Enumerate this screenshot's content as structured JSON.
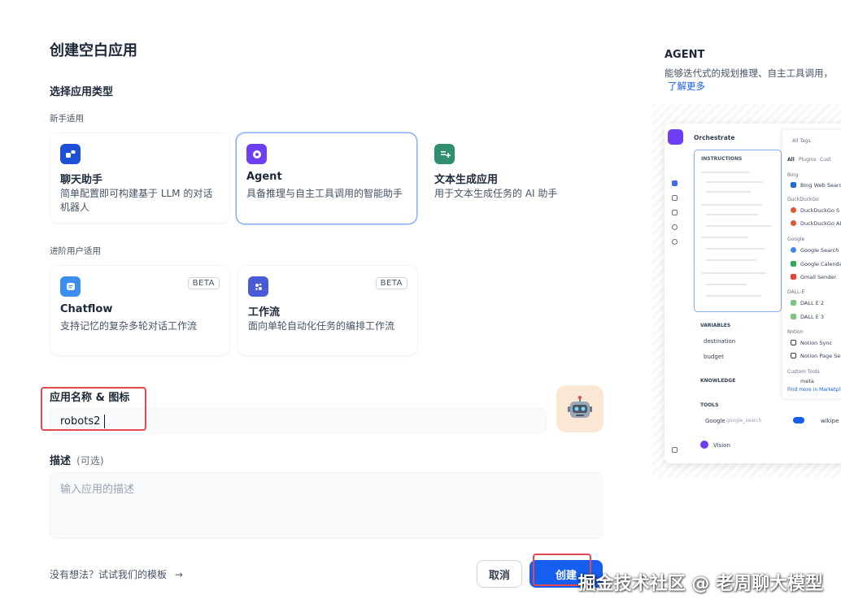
{
  "dialog": {
    "title": "创建空白应用",
    "type_section": "选择应用类型",
    "beginner_label": "新手适用",
    "advanced_label": "进阶用户适用",
    "app_types_beginner": [
      {
        "name": "聊天助手",
        "desc": "简单配置即可构建基于 LLM 的对话机器人",
        "icon": "chat-bot-icon",
        "color": "#1e4fd8"
      },
      {
        "name": "Agent",
        "desc": "具备推理与自主工具调用的智能助手",
        "icon": "agent-icon",
        "color": "#6e3ef2",
        "selected": true
      },
      {
        "name": "文本生成应用",
        "desc": "用于文本生成任务的 AI 助手",
        "icon": "text-generate-icon",
        "color": "#2f8f6f"
      }
    ],
    "app_types_advanced": [
      {
        "name": "Chatflow",
        "desc": "支持记忆的复杂多轮对话工作流",
        "icon": "chatflow-icon",
        "color": "#3b8df0",
        "badge": "BETA"
      },
      {
        "name": "工作流",
        "desc": "面向单轮自动化任务的编排工作流",
        "icon": "workflow-icon",
        "color": "#4a5bd6",
        "badge": "BETA"
      }
    ],
    "name_section": "应用名称 & 图标",
    "name_value": "robots2",
    "app_icon": "robot-emoji-icon",
    "app_icon_glyph": "🤖",
    "desc_section": "描述",
    "desc_optional": "(可选)",
    "desc_placeholder": "输入应用的描述",
    "template_hint": "没有想法？试试我们的模板",
    "template_arrow": "→",
    "cancel_label": "取消",
    "create_label": "创建"
  },
  "preview": {
    "heading": "AGENT",
    "desc": "能够迭代式的规划推理、自主工具调用，",
    "learn_more": "了解更多",
    "orchestrate": "Orchestrate",
    "instructions": "INSTRUCTIONS",
    "variables": "VARIABLES",
    "var1": "destination",
    "var2": "budget",
    "knowledge": "KNOWLEDGE",
    "tools": "TOOLS",
    "tool1": "Google",
    "tool1_sub": "google_search",
    "tool2": "wikipe",
    "vision": "Vision",
    "all_tags": "All Tags",
    "tab_all": "All",
    "tab_plugins": "Plugins",
    "tab_custom": "Cust",
    "groups": [
      {
        "label": "Bing",
        "items": [
          "Bing Web Search"
        ]
      },
      {
        "label": "DuckDuckGo",
        "items": [
          "DuckDuckGo S",
          "DuckDuckGo AI"
        ]
      },
      {
        "label": "Google",
        "items": [
          "Google Search",
          "Google Calenda",
          "Gmail Sender"
        ]
      },
      {
        "label": "DALL-E",
        "items": [
          "DALL E 2",
          "DALL E 3"
        ]
      },
      {
        "label": "Notion",
        "items": [
          "Notion Sync",
          "Notion Page Se"
        ]
      },
      {
        "label": "Custom Tools",
        "items": [
          "meta"
        ]
      }
    ],
    "find_more": "Find more in Marketpl"
  },
  "watermark": "掘金技术社区 @ 老周聊大模型"
}
